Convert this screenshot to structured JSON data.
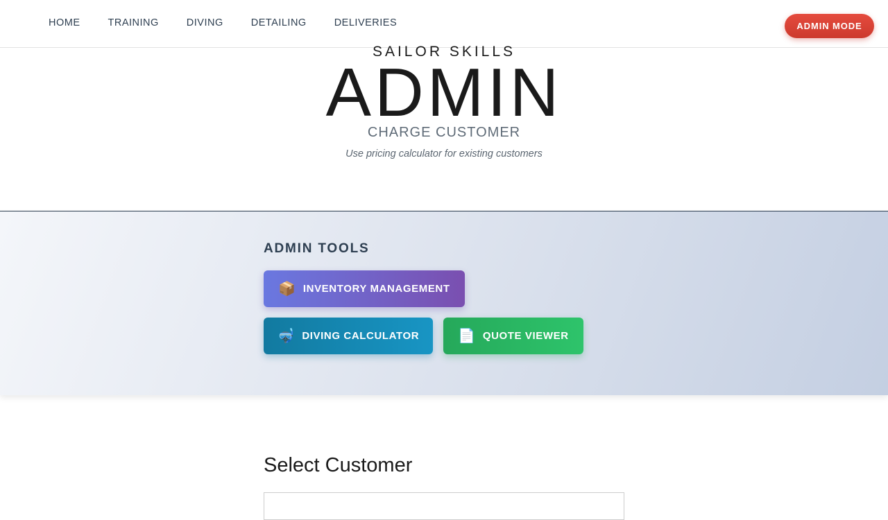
{
  "nav": {
    "items": [
      {
        "label": "HOME"
      },
      {
        "label": "TRAINING"
      },
      {
        "label": "DIVING"
      },
      {
        "label": "DETAILING"
      },
      {
        "label": "DELIVERIES"
      }
    ],
    "admin_mode_label": "ADMIN MODE"
  },
  "hero": {
    "brand": "SAILOR SKILLS",
    "title": "ADMIN",
    "subtitle": "CHARGE CUSTOMER",
    "note": "Use pricing calculator for existing customers"
  },
  "admin_tools": {
    "heading": "ADMIN TOOLS",
    "buttons": [
      {
        "icon": "📦",
        "label": "INVENTORY MANAGEMENT"
      },
      {
        "icon": "🤿",
        "label": "DIVING CALCULATOR"
      },
      {
        "icon": "📄",
        "label": "QUOTE VIEWER"
      }
    ]
  },
  "customer": {
    "heading": "Select Customer"
  },
  "colors": {
    "nav_text": "#2d3e50",
    "admin_mode": "#d9423a",
    "inventory_button": "#6a78e0",
    "diving_button": "#127aa0",
    "quote_button": "#25a85a"
  }
}
